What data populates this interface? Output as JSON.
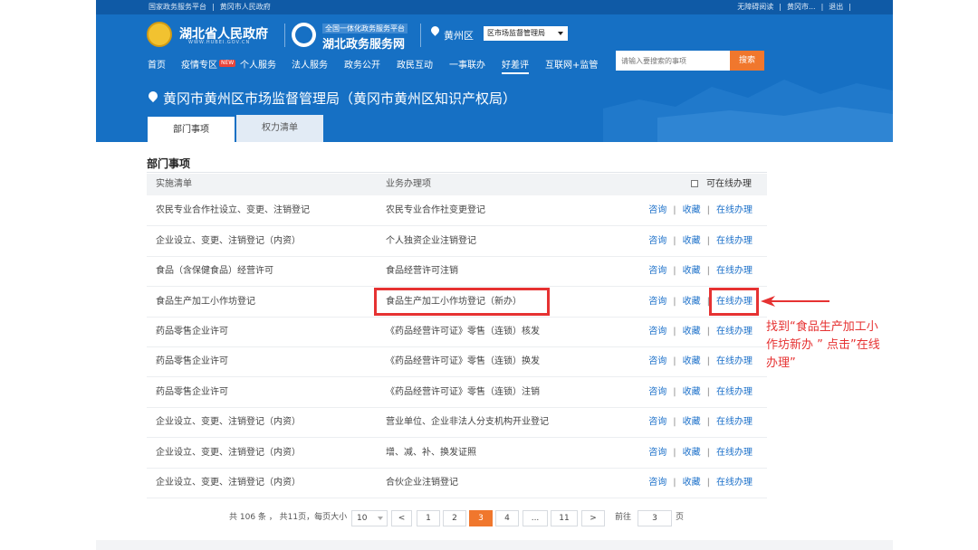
{
  "topbar": {
    "left": [
      "国家政务服务平台",
      "|",
      "黄冈市人民政府"
    ],
    "right": [
      "无障碍阅读",
      "|",
      "黄冈市...",
      "|",
      "退出",
      "|"
    ]
  },
  "brand": {
    "gov_title": "湖北省人民政府",
    "gov_sub": "WWW.HUBEI.GOV.CN",
    "platform_small": "全国一体化政务服务平台",
    "platform_title": "湖北政务服务网"
  },
  "location": {
    "name": "黄州区",
    "selected_dept": "区市场监督管理局"
  },
  "nav": {
    "items": [
      "首页",
      "疫情专区",
      "个人服务",
      "法人服务",
      "政务公开",
      "政民互动",
      "一事联办",
      "好差评",
      "互联网+监管"
    ],
    "badge": "NEW",
    "active_index": 7
  },
  "search": {
    "placeholder": "请输入要搜索的事项",
    "button": "搜索"
  },
  "dept_title": "黄冈市黄州区市场监督管理局（黄冈市黄州区知识产权局）",
  "tabs": [
    "部门事项",
    "权力清单"
  ],
  "section": {
    "title": "部门事项",
    "headers": [
      "实施清单",
      "业务办理项"
    ],
    "online_filter_label": "可在线办理"
  },
  "actions": [
    "咨询",
    "收藏",
    "在线办理"
  ],
  "rows": [
    [
      "农民专业合作社设立、变更、注销登记",
      "农民专业合作社变更登记"
    ],
    [
      "企业设立、变更、注销登记（内资）",
      "个人独资企业注销登记"
    ],
    [
      "食品（含保健食品）经营许可",
      "食品经营许可注销"
    ],
    [
      "食品生产加工小作坊登记",
      "食品生产加工小作坊登记（新办）"
    ],
    [
      "药品零售企业许可",
      "《药品经营许可证》零售（连锁）核发"
    ],
    [
      "药品零售企业许可",
      "《药品经营许可证》零售（连锁）换发"
    ],
    [
      "药品零售企业许可",
      "《药品经营许可证》零售（连锁）注销"
    ],
    [
      "企业设立、变更、注销登记（内资）",
      "营业单位、企业非法人分支机构开业登记"
    ],
    [
      "企业设立、变更、注销登记（内资）",
      "增、减、补、换发证照"
    ],
    [
      "企业设立、变更、注销登记（内资）",
      "合伙企业注销登记"
    ]
  ],
  "annotation": "找到“食品生产加工小作坊新办 ” 点击”在线办理”",
  "pagination": {
    "summary": "共 106 条 ， 共11页，每页大小",
    "page_size": "10",
    "prev": "<",
    "next": ">",
    "pages": [
      "1",
      "2",
      "3",
      "4",
      "...",
      "11"
    ],
    "active": "3",
    "goto_label": "前往",
    "goto_value": "3",
    "goto_unit": "页"
  },
  "colors": {
    "primary": "#1670c4",
    "accent": "#f0772d",
    "highlight": "#e63232",
    "link": "#1a6fc9"
  }
}
